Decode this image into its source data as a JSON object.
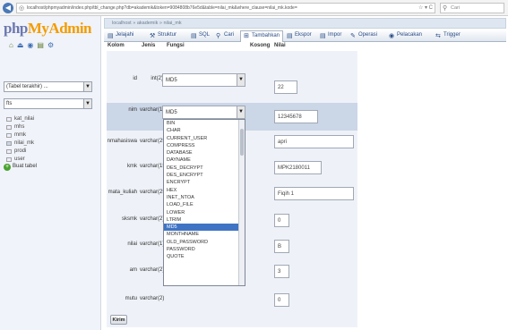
{
  "browser": {
    "url": "localhost/phpmyadmin/index.php/tbl_change.php?db=akademik&token=9084808b76e5d&table=nilai_mk&where_clause=nilai_mk.kode=",
    "url_icons": "☆ ▾ C",
    "search_placeholder": "Cari"
  },
  "nav": {
    "logo_part1": "php",
    "logo_part2": "MyAdmin",
    "db_select": "(Tabel terakhir) ...",
    "table_select": "fts",
    "tables": [
      {
        "name": "kat_nilai",
        "selected": false
      },
      {
        "name": "mhs",
        "selected": false
      },
      {
        "name": "mmk",
        "selected": false
      },
      {
        "name": "nilai_mk",
        "selected": true
      },
      {
        "name": "prodi",
        "selected": false
      },
      {
        "name": "user",
        "selected": false
      }
    ],
    "create_table": "Buat tabel"
  },
  "breadcrumb": "localhost » akademik » nilai_mk",
  "tabs": [
    {
      "label": "Jelajahi",
      "icon": "▤",
      "active": false
    },
    {
      "label": "Struktur",
      "icon": "⚒",
      "active": false
    },
    {
      "label": "SQL",
      "icon": "▤",
      "active": false
    },
    {
      "label": "Cari",
      "icon": "⚲",
      "active": false
    },
    {
      "label": "Tambahkan",
      "icon": "⊞",
      "active": true
    },
    {
      "label": "Ekspor",
      "icon": "▤",
      "active": false
    },
    {
      "label": "Impor",
      "icon": "▤",
      "active": false
    },
    {
      "label": "Operasi",
      "icon": "✎",
      "active": false
    },
    {
      "label": "Pelacakan",
      "icon": "◉",
      "active": false
    },
    {
      "label": "Trigger",
      "icon": "⇆",
      "active": false
    }
  ],
  "columns_header": {
    "kolom": "Kolom",
    "jenis": "Jenis",
    "fungsi": "Fungsi",
    "kosong": "Kosong",
    "nilai": "Nilai"
  },
  "rows": [
    {
      "name": "id",
      "type": "int(2)",
      "function": "MD5",
      "value": "22"
    },
    {
      "name": "nim",
      "type": "varchar(15)",
      "function": "MD5",
      "value": "12345678"
    },
    {
      "name": "nmahasiswa",
      "type": "varchar(25)",
      "function": "",
      "value": "apri"
    },
    {
      "name": "kmk",
      "type": "varchar(15)",
      "function": "",
      "value": "MPK2180011"
    },
    {
      "name": "mata_kuliah",
      "type": "varchar(25)",
      "function": "",
      "value": "Fiqih 1"
    },
    {
      "name": "sksmk",
      "type": "varchar(2)",
      "function": "",
      "value": "0"
    },
    {
      "name": "nilai",
      "type": "varchar(1)",
      "function": "",
      "value": "B"
    },
    {
      "name": "am",
      "type": "varchar(2)",
      "function": "",
      "value": "3"
    },
    {
      "name": "mutu",
      "type": "varchar(2)",
      "function": "",
      "value": "0"
    }
  ],
  "function_options": [
    "BIN",
    "CHAR",
    "CURRENT_USER",
    "COMPRESS",
    "DATABASE",
    "DAYNAME",
    "DES_DECRYPT",
    "DES_ENCRYPT",
    "ENCRYPT",
    "HEX",
    "INET_NTOA",
    "LOAD_FILE",
    "LOWER",
    "LTRIM",
    "MD5",
    "MONTHNAME",
    "OLD_PASSWORD",
    "PASSWORD",
    "QUOTE"
  ],
  "selected_option": "MD5",
  "submit_label": "Kirim"
}
